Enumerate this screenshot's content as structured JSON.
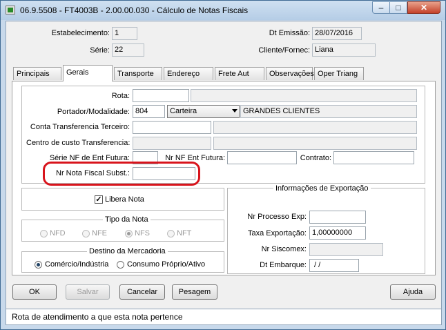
{
  "window": {
    "title": "06.9.5508 - FT4003B - 2.00.00.030 - Cálculo de Notas Fiscais",
    "minimize": "–",
    "maximize": "□",
    "close": "✕"
  },
  "header": {
    "estabelecimento_label": "Estabelecimento:",
    "estabelecimento_value": "1",
    "serie_label": "Série:",
    "serie_value": "22",
    "dt_emissao_label": "Dt Emissão:",
    "dt_emissao_value": "28/07/2016",
    "cliente_label": "Cliente/Fornec:",
    "cliente_value": "Liana"
  },
  "tabs": [
    {
      "label": "Principais"
    },
    {
      "label": "Gerais"
    },
    {
      "label": "Transporte"
    },
    {
      "label": "Endereço"
    },
    {
      "label": "Frete Aut"
    },
    {
      "label": "Observações"
    },
    {
      "label": "Oper Triang"
    }
  ],
  "gerais": {
    "rota_label": "Rota:",
    "rota_value": "",
    "rota_desc": "",
    "portador_label": "Portador/Modalidade:",
    "portador_value": "804",
    "modalidade_value": "Carteira",
    "portador_desc": "GRANDES CLIENTES",
    "conta_transf_label": "Conta Transferencia Terceiro:",
    "conta_transf_value": "",
    "conta_transf_desc": "",
    "centro_custo_label": "Centro de custo Transferencia:",
    "centro_custo_value": "",
    "centro_custo_desc": "",
    "serie_nf_label": "Série NF de Ent Futura:",
    "serie_nf_value": "",
    "nr_nf_label": "Nr NF Ent Futura:",
    "nr_nf_value": "",
    "contrato_label": "Contrato:",
    "contrato_value": "",
    "nr_nota_subst_label": "Nr Nota Fiscal Subst.:",
    "nr_nota_subst_value": ""
  },
  "libera_nota": {
    "label": "Libera Nota",
    "checked": true,
    "mark": "✓"
  },
  "tipo_nota": {
    "title": "Tipo da Nota",
    "options": [
      "NFD",
      "NFE",
      "NFS",
      "NFT"
    ],
    "selected": "NFS"
  },
  "destino": {
    "title": "Destino da Mercadoria",
    "options": [
      "Comércio/Indústria",
      "Consumo Próprio/Ativo"
    ],
    "selected": "Comércio/Indústria"
  },
  "exportacao": {
    "title": "Informações de Exportação",
    "nr_processo_label": "Nr Processo Exp:",
    "nr_processo_value": "",
    "taxa_label": "Taxa Exportação:",
    "taxa_value": "1,00000000",
    "nr_siscomex_label": "Nr Siscomex:",
    "nr_siscomex_value": "",
    "dt_embarque_label": "Dt Embarque:",
    "dt_embarque_value": " / /"
  },
  "buttons": {
    "ok": "OK",
    "salvar": "Salvar",
    "cancelar": "Cancelar",
    "pesagem": "Pesagem",
    "ajuda": "Ajuda"
  },
  "status": {
    "text": "Rota de atendimento a que esta nota pertence"
  },
  "colors": {
    "highlight": "#d8141c",
    "titlebar": "#c4d7ec",
    "close": "#c4422a"
  }
}
